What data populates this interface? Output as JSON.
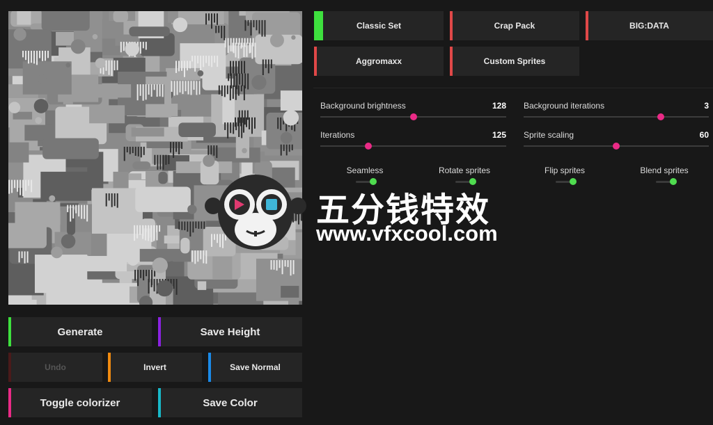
{
  "sets": [
    {
      "label": "Classic Set",
      "accent": "#3ee03e",
      "active": true
    },
    {
      "label": "Crap Pack",
      "accent": "#e04848",
      "active": false
    },
    {
      "label": "BIG:DATA",
      "accent": "#e04848",
      "active": false
    },
    {
      "label": "Aggromaxx",
      "accent": "#e04848",
      "active": false
    },
    {
      "label": "Custom Sprites",
      "accent": "#e04848",
      "active": false
    }
  ],
  "sliders": [
    {
      "label": "Background brightness",
      "value": "128",
      "fraction": 0.5
    },
    {
      "label": "Background iterations",
      "value": "3",
      "fraction": 0.74
    },
    {
      "label": "Iterations",
      "value": "125",
      "fraction": 0.26
    },
    {
      "label": "Sprite scaling",
      "value": "60",
      "fraction": 0.5
    }
  ],
  "toggles": [
    {
      "label": "Seamless",
      "on": true
    },
    {
      "label": "Rotate sprites",
      "on": true
    },
    {
      "label": "Flip sprites",
      "on": true
    },
    {
      "label": "Blend sprites",
      "on": true
    }
  ],
  "actions": {
    "generate": "Generate",
    "save_height": "Save Height",
    "undo": "Undo",
    "invert": "Invert",
    "save_normal": "Save Normal",
    "toggle_colorizer": "Toggle colorizer",
    "save_color": "Save Color"
  },
  "action_colors": {
    "generate": "#3ee03e",
    "save_height": "#8a22e0",
    "undo": "#4a1a1a",
    "invert": "#f08a10",
    "save_normal": "#1a8ae8",
    "toggle_colorizer": "#ea2a86",
    "save_color": "#18b8c8"
  },
  "watermark": {
    "title": "五分钱特效",
    "url": "www.vfxcool.com"
  }
}
